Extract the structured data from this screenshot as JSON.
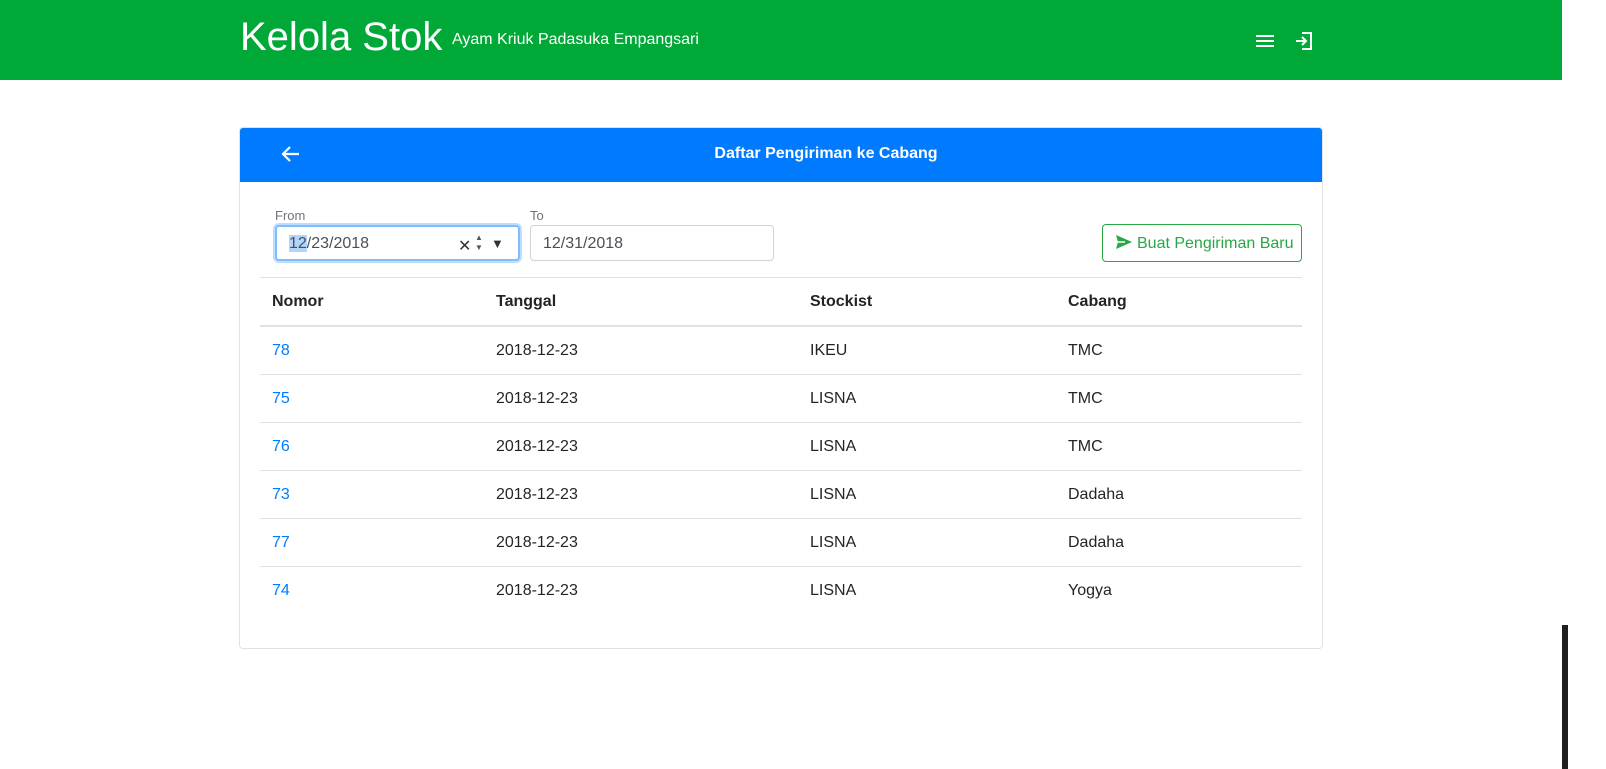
{
  "app": {
    "title": "Kelola Stok",
    "subtitle": "Ayam Kriuk Padasuka Empangsari",
    "brand_color": "#00a838",
    "icons": [
      "menu-icon",
      "logout-icon"
    ]
  },
  "card": {
    "title": "Daftar Pengiriman ke Cabang",
    "header_color": "#007bff",
    "back_icon": "arrow-left-icon"
  },
  "filters": {
    "from": {
      "label": "From",
      "month": "12",
      "rest": "/23/2018"
    },
    "to": {
      "label": "To",
      "value": "12/31/2018"
    }
  },
  "actions": {
    "new_shipment_label": "Buat Pengiriman Baru",
    "new_shipment_icon": "send-icon"
  },
  "table": {
    "headers": [
      "Nomor",
      "Tanggal",
      "Stockist",
      "Cabang"
    ],
    "rows": [
      [
        "78",
        "2018-12-23",
        "IKEU",
        "TMC"
      ],
      [
        "75",
        "2018-12-23",
        "LISNA",
        "TMC"
      ],
      [
        "76",
        "2018-12-23",
        "LISNA",
        "TMC"
      ],
      [
        "73",
        "2018-12-23",
        "LISNA",
        "Dadaha"
      ],
      [
        "77",
        "2018-12-23",
        "LISNA",
        "Dadaha"
      ],
      [
        "74",
        "2018-12-23",
        "LISNA",
        "Yogya"
      ]
    ]
  }
}
